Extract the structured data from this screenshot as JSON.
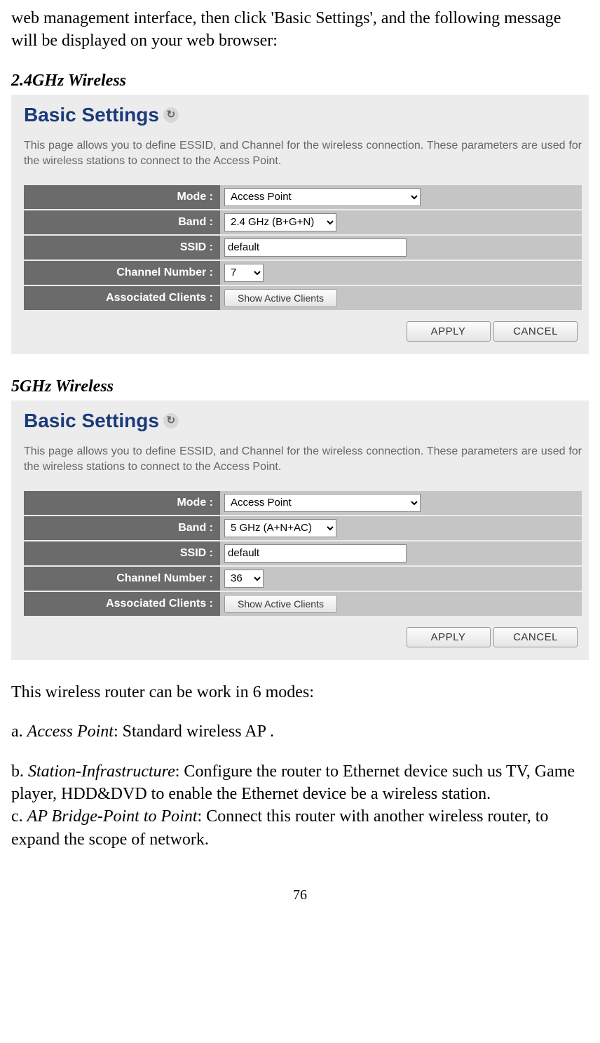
{
  "intro_text": "web management interface, then click 'Basic Settings', and the following message will be displayed on your web browser:",
  "sections": {
    "s24": {
      "heading": "2.4GHz Wireless",
      "panel_title": "Basic Settings",
      "desc": "This page allows you to define ESSID, and Channel for the wireless connection. These parameters are used for the wireless stations to connect to the Access Point.",
      "rows": {
        "mode": {
          "label": "Mode :",
          "value": "Access Point"
        },
        "band": {
          "label": "Band :",
          "value": "2.4 GHz (B+G+N)"
        },
        "ssid": {
          "label": "SSID :",
          "value": "default"
        },
        "channel": {
          "label": "Channel Number :",
          "value": "7"
        },
        "clients": {
          "label": "Associated Clients :",
          "button": "Show Active Clients"
        }
      },
      "apply": "APPLY",
      "cancel": "CANCEL"
    },
    "s5": {
      "heading": "5GHz Wireless",
      "panel_title": "Basic Settings",
      "desc": "This page allows you to define ESSID, and Channel for the wireless connection. These parameters are used for the wireless stations to connect to the Access Point.",
      "rows": {
        "mode": {
          "label": "Mode :",
          "value": "Access Point"
        },
        "band": {
          "label": "Band :",
          "value": "5 GHz (A+N+AC)"
        },
        "ssid": {
          "label": "SSID :",
          "value": "default"
        },
        "channel": {
          "label": "Channel Number :",
          "value": "36"
        },
        "clients": {
          "label": "Associated Clients :",
          "button": "Show Active Clients"
        }
      },
      "apply": "APPLY",
      "cancel": "CANCEL"
    }
  },
  "body": {
    "p1": "This wireless router can be work in 6 modes:",
    "a_prefix": "a. ",
    "a_label": "Access Point",
    "a_rest": ": Standard wireless AP .",
    "b_prefix": "b. ",
    "b_label": "Station-Infrastructure",
    "b_rest": ": Configure the router to Ethernet device such us TV, Game player, HDD&DVD to enable the Ethernet device be a wireless station.",
    "c_prefix": "c. ",
    "c_label": "AP Bridge-Point to Point",
    "c_rest": ": Connect this router with another wireless router, to expand the scope of network."
  },
  "page_number": "76"
}
